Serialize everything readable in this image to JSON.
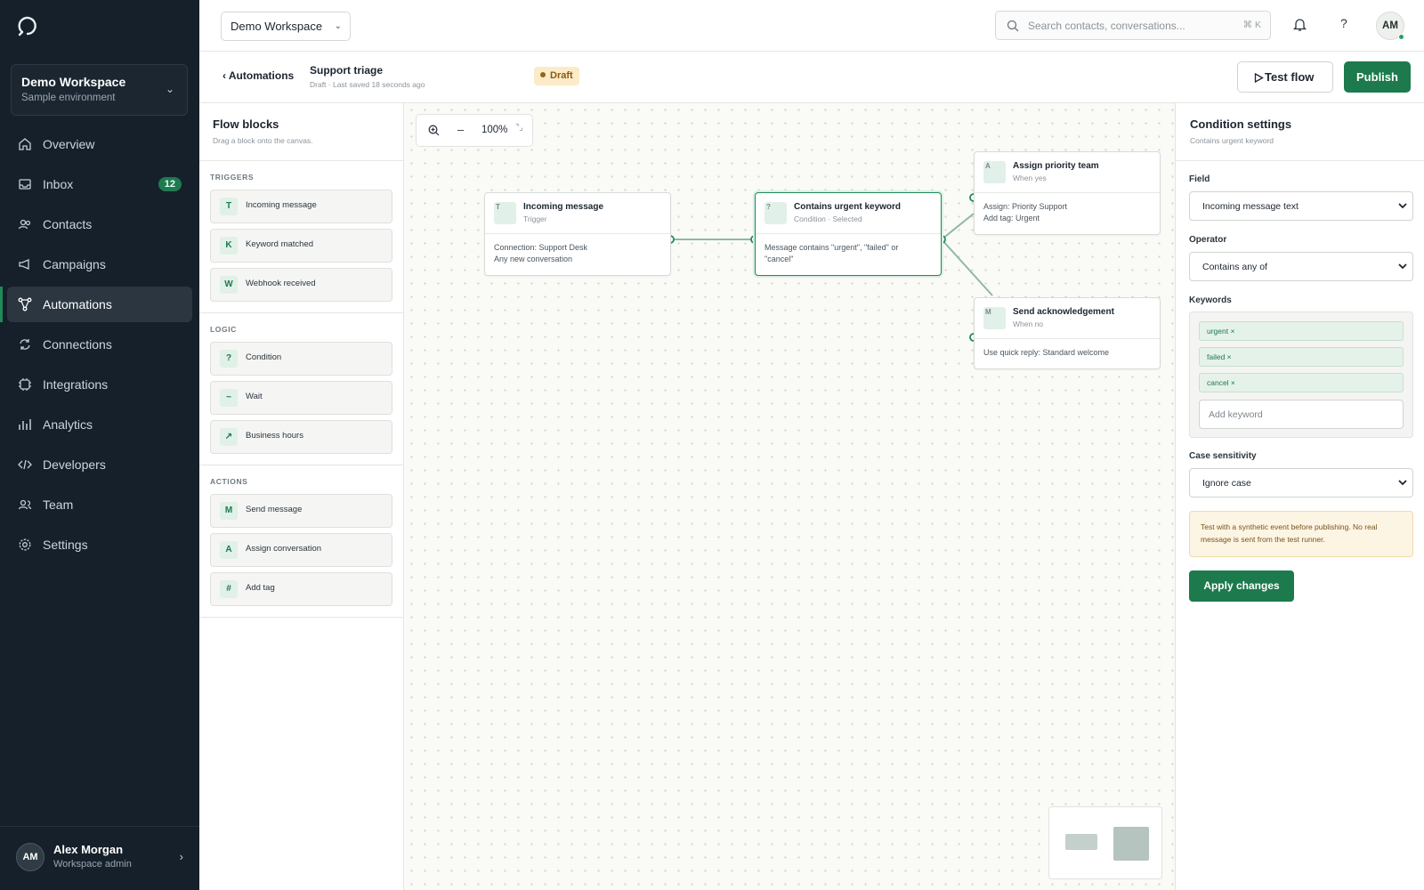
{
  "app": {
    "workspace_name": "Demo Workspace",
    "workspace_env": "Sample environment"
  },
  "nav": [
    {
      "label": "Overview",
      "icon": "home-icon"
    },
    {
      "label": "Inbox",
      "icon": "inbox-icon",
      "badge": "12"
    },
    {
      "label": "Contacts",
      "icon": "contacts-icon"
    },
    {
      "label": "Campaigns",
      "icon": "megaphone-icon"
    },
    {
      "label": "Automations",
      "icon": "automations-icon",
      "active": true
    },
    {
      "label": "Connections",
      "icon": "sync-icon"
    },
    {
      "label": "Integrations",
      "icon": "plug-icon"
    },
    {
      "label": "Analytics",
      "icon": "bar-chart-icon"
    },
    {
      "label": "Developers",
      "icon": "code-icon"
    },
    {
      "label": "Team",
      "icon": "team-icon"
    },
    {
      "label": "Settings",
      "icon": "gear-icon"
    }
  ],
  "user": {
    "initials": "AM",
    "name": "Alex Morgan",
    "role": "Workspace admin"
  },
  "topbar": {
    "workspace_select": "Demo Workspace",
    "search_placeholder": "Search contacts, conversations...",
    "search_shortcut": "⌘ K",
    "help": "?",
    "avatar_initials": "AM"
  },
  "subheader": {
    "back_label": "Automations",
    "flow_title": "Support triage",
    "flow_meta": "Draft · Last saved 18 seconds ago",
    "status": "Draft",
    "test_label": "Test flow",
    "publish_label": "Publish"
  },
  "blocks_panel": {
    "title": "Flow blocks",
    "subtitle": "Drag a block onto the canvas.",
    "groups": [
      {
        "label": "TRIGGERS",
        "items": [
          {
            "icon": "T",
            "label": "Incoming message"
          },
          {
            "icon": "K",
            "label": "Keyword matched"
          },
          {
            "icon": "W",
            "label": "Webhook received"
          }
        ]
      },
      {
        "label": "LOGIC",
        "items": [
          {
            "icon": "?",
            "label": "Condition"
          },
          {
            "icon": "~",
            "label": "Wait"
          },
          {
            "icon": "↗",
            "label": "Business hours"
          }
        ]
      },
      {
        "label": "ACTIONS",
        "items": [
          {
            "icon": "M",
            "label": "Send message"
          },
          {
            "icon": "A",
            "label": "Assign conversation"
          },
          {
            "icon": "#",
            "label": "Add tag"
          }
        ]
      }
    ]
  },
  "canvas": {
    "zoom_level": "100%",
    "nodes": [
      {
        "icon": "T",
        "title": "Incoming message",
        "subtitle": "Trigger",
        "body": [
          "Connection: Support Desk",
          "Any new conversation"
        ]
      },
      {
        "icon": "?",
        "title": "Contains urgent keyword",
        "subtitle": "Condition · Selected",
        "body": [
          "Message contains \"urgent\", \"failed\" or",
          "\"cancel\""
        ],
        "selected": true
      },
      {
        "icon": "A",
        "title": "Assign priority team",
        "subtitle": "When yes",
        "body": [
          "Assign: Priority Support",
          "Add tag: Urgent"
        ]
      },
      {
        "icon": "M",
        "title": "Send acknowledgement",
        "subtitle": "When no",
        "body": [
          "Use quick reply: Standard welcome"
        ]
      }
    ]
  },
  "settings": {
    "title": "Condition settings",
    "subtitle": "Contains urgent keyword",
    "field_label": "Field",
    "field_value": "Incoming message text",
    "operator_label": "Operator",
    "operator_value": "Contains any of",
    "keywords_label": "Keywords",
    "keywords": [
      "urgent ×",
      "failed ×",
      "cancel ×"
    ],
    "keyword_placeholder": "Add keyword",
    "case_label": "Case sensitivity",
    "case_value": "Ignore case",
    "note": "Test with a synthetic event before publishing. No real message is sent from the test runner.",
    "apply_label": "Apply changes"
  },
  "colors": {
    "accent": "#1c7a4d",
    "sidebar": "#16202a",
    "draft_badge": "#fbebc9"
  }
}
